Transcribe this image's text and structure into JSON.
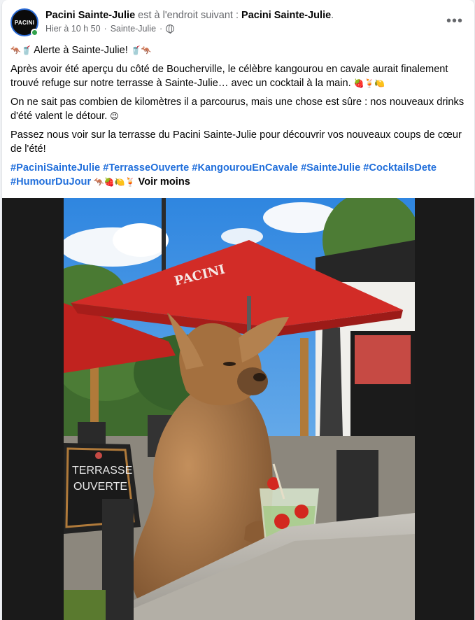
{
  "header": {
    "page_name": "Pacini Sainte-Julie",
    "location_text": "est à l'endroit suivant :",
    "location_name": "Pacini Sainte-Julie",
    "location_suffix": ".",
    "avatar_text": "PACINI",
    "timestamp": "Hier à 10 h 50",
    "place": "Sainte-Julie",
    "separator": "·",
    "more_label": "•••",
    "privacy_icon": "globe-icon"
  },
  "post": {
    "line1_prefix": "🦘🥤",
    "line1_text": " Alerte à Sainte-Julie! ",
    "line1_suffix": "🥤🦘",
    "paragraph1": "Après avoir été aperçu du côté de Boucherville, le célèbre kangourou en cavale aurait finalement trouvé refuge sur notre terrasse à Sainte-Julie… avec un cocktail à la main.",
    "paragraph1_emoji": " 🍓🍹🍋",
    "paragraph2": "On ne sait pas combien de kilomètres il a parcourus, mais une chose est sûre : nos nouveaux drinks d'été valent le détour.",
    "paragraph2_emoji": " 😉",
    "paragraph3": "Passez nous voir sur la terrasse du Pacini Sainte-Julie pour découvrir vos nouveaux coups de cœur de l'été!",
    "hashtags": [
      "#PaciniSainteJulie",
      "#TerrasseOuverte",
      "#KangourouEnCavale",
      "#SainteJulie",
      "#CocktailsDete",
      "#HumourDuJour"
    ],
    "hashtags_emoji": " 🦘🍓🍋🍹 ",
    "see_less": "Voir moins"
  },
  "photo": {
    "sign_line1": "TERRASSE",
    "sign_line2": "OUVERTE",
    "umbrella_text": "PACINI",
    "colors": {
      "sky": "#4a9ae3",
      "umbrella": "#cc2a26",
      "kangaroo": "#a9784a",
      "foliage": "#3f6b2e",
      "table": "#b9b5ad"
    }
  },
  "colors": {
    "link": "#216fdb",
    "muted": "#65676b",
    "online": "#31a24c"
  }
}
